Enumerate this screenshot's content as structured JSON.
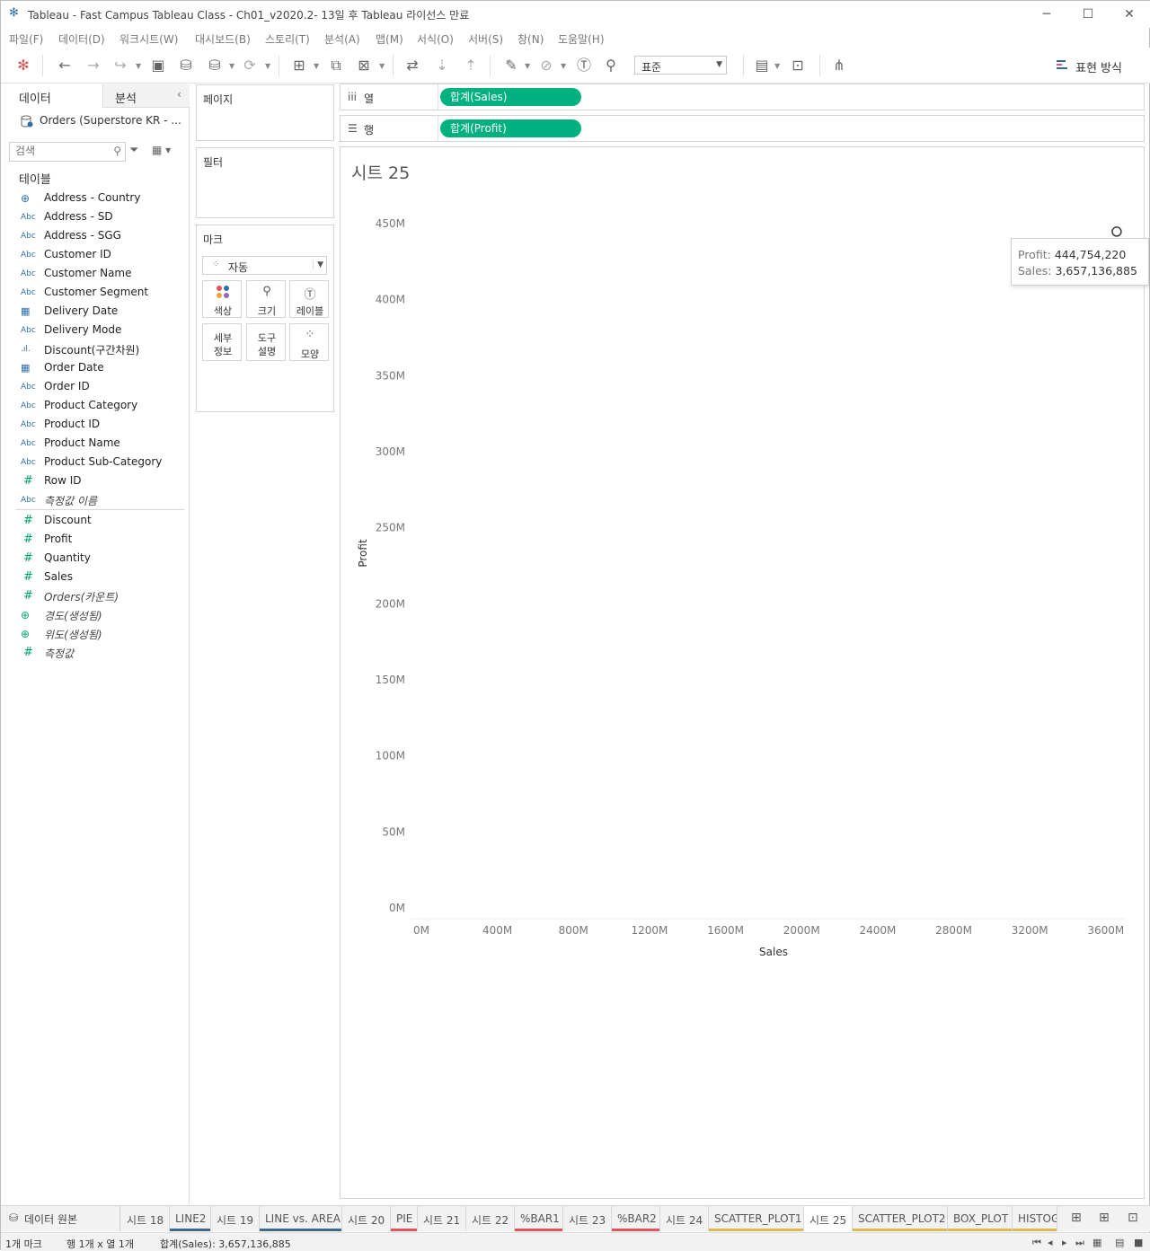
{
  "window": {
    "title": "Tableau - Fast Campus Tableau Class - Ch01_v2020.2- 13일 후 Tableau 라이선스 만료",
    "buttons": [
      "minimize-icon",
      "maximize-icon",
      "close-icon"
    ]
  },
  "menu": [
    "파일(F)",
    "데이터(D)",
    "워크시트(W)",
    "대시보드(B)",
    "스토리(T)",
    "분석(A)",
    "맵(M)",
    "서식(O)",
    "서버(S)",
    "창(N)",
    "도움말(H)"
  ],
  "toolbar": {
    "fit_select": "표준",
    "show_me_label": "표현 방식"
  },
  "data_pane": {
    "tab_data": "데이터",
    "tab_analysis": "분석",
    "datasource": "Orders (Superstore KR - ...",
    "search_placeholder": "검색",
    "tables_heading": "테이블",
    "dimensions": [
      {
        "icon": "globe",
        "label": "Address - Country",
        "italic": false
      },
      {
        "icon": "abc",
        "label": "Address - SD",
        "italic": false
      },
      {
        "icon": "abc",
        "label": "Address - SGG",
        "italic": false
      },
      {
        "icon": "abc",
        "label": "Customer ID",
        "italic": false
      },
      {
        "icon": "abc",
        "label": "Customer Name",
        "italic": false
      },
      {
        "icon": "abc",
        "label": "Customer Segment",
        "italic": false
      },
      {
        "icon": "calendar",
        "label": "Delivery Date",
        "italic": false
      },
      {
        "icon": "abc",
        "label": "Delivery Mode",
        "italic": false
      },
      {
        "icon": "bin",
        "label": "Discount(구간차원)",
        "italic": false
      },
      {
        "icon": "calendar",
        "label": "Order Date",
        "italic": false
      },
      {
        "icon": "abc",
        "label": "Order ID",
        "italic": false
      },
      {
        "icon": "abc",
        "label": "Product Category",
        "italic": false
      },
      {
        "icon": "abc",
        "label": "Product ID",
        "italic": false
      },
      {
        "icon": "abc",
        "label": "Product Name",
        "italic": false
      },
      {
        "icon": "abc",
        "label": "Product Sub-Category",
        "italic": false
      },
      {
        "icon": "hash",
        "label": "Row ID",
        "italic": false
      },
      {
        "icon": "abc",
        "label": "측정값 이름",
        "italic": true
      }
    ],
    "measures": [
      {
        "icon": "hash",
        "label": "Discount",
        "italic": false
      },
      {
        "icon": "hash",
        "label": "Profit",
        "italic": false
      },
      {
        "icon": "hash",
        "label": "Quantity",
        "italic": false
      },
      {
        "icon": "hash",
        "label": "Sales",
        "italic": false
      },
      {
        "icon": "hash",
        "label": "Orders(카운트)",
        "italic": true
      },
      {
        "icon": "globe",
        "label": "경도(생성됨)",
        "italic": true
      },
      {
        "icon": "globe",
        "label": "위도(생성됨)",
        "italic": true
      },
      {
        "icon": "hash",
        "label": "측정값",
        "italic": true
      }
    ]
  },
  "cards": {
    "pages": "페이지",
    "filters": "필터",
    "marks": "마크",
    "marks_type": "자동",
    "mark_buttons": {
      "color": "색상",
      "size": "크기",
      "label": "레이블",
      "detail_1": "세부",
      "detail_2": "정보",
      "tooltip_1": "도구",
      "tooltip_2": "설명",
      "shape": "모양"
    }
  },
  "shelves": {
    "columns_label": "열",
    "columns_pill": "합계(Sales)",
    "rows_label": "행",
    "rows_pill": "합계(Profit)"
  },
  "sheet_title": "시트 25",
  "chart_data": {
    "type": "scatter",
    "title": "",
    "xlabel": "Sales",
    "ylabel": "Profit",
    "xlim": [
      0,
      3700000000
    ],
    "ylim": [
      0,
      450000000
    ],
    "x_ticks": [
      "0M",
      "400M",
      "800M",
      "1200M",
      "1600M",
      "2000M",
      "2400M",
      "2800M",
      "3200M",
      "3600M"
    ],
    "y_ticks": [
      "0M",
      "50M",
      "100M",
      "150M",
      "200M",
      "250M",
      "300M",
      "350M",
      "400M",
      "450M"
    ],
    "points": [
      {
        "x": 3657136885,
        "y": 444754220
      }
    ],
    "grid": false
  },
  "tooltip": {
    "profit_label": "Profit:",
    "profit_value": "444,754,220",
    "sales_label": "Sales:",
    "sales_value": "3,657,136,885"
  },
  "sheet_tabs": {
    "datasource": "데이터 원본",
    "tabs": [
      {
        "label": "시트 18",
        "accent": ""
      },
      {
        "label": "LINE2",
        "accent": "#3e6a8e"
      },
      {
        "label": "시트 19",
        "accent": ""
      },
      {
        "label": "LINE vs. AREA",
        "accent": "#3e6a8e"
      },
      {
        "label": "시트 20",
        "accent": ""
      },
      {
        "label": "PIE",
        "accent": "#e8505b"
      },
      {
        "label": "시트 21",
        "accent": ""
      },
      {
        "label": "시트 22",
        "accent": ""
      },
      {
        "label": "%BAR1",
        "accent": "#e8505b"
      },
      {
        "label": "시트 23",
        "accent": ""
      },
      {
        "label": "%BAR2",
        "accent": "#e8505b"
      },
      {
        "label": "시트 24",
        "accent": ""
      },
      {
        "label": "SCATTER_PLOT1",
        "accent": "#e0b84f"
      },
      {
        "label": "시트 25",
        "accent": "",
        "active": true
      },
      {
        "label": "SCATTER_PLOT2",
        "accent": "#e0b84f"
      },
      {
        "label": "BOX_PLOT",
        "accent": "#e0b84f"
      },
      {
        "label": "HISTOGRAM",
        "accent": "#e0b84f"
      }
    ]
  },
  "status": {
    "marks": "1개 마크",
    "rowcol": "행 1개 x 열 1개",
    "sum": "합계(Sales): 3,657,136,885"
  },
  "colors": {
    "pill": "#00b180",
    "accent_blue": "#2f6fa7",
    "measure_green": "#00a56a"
  }
}
